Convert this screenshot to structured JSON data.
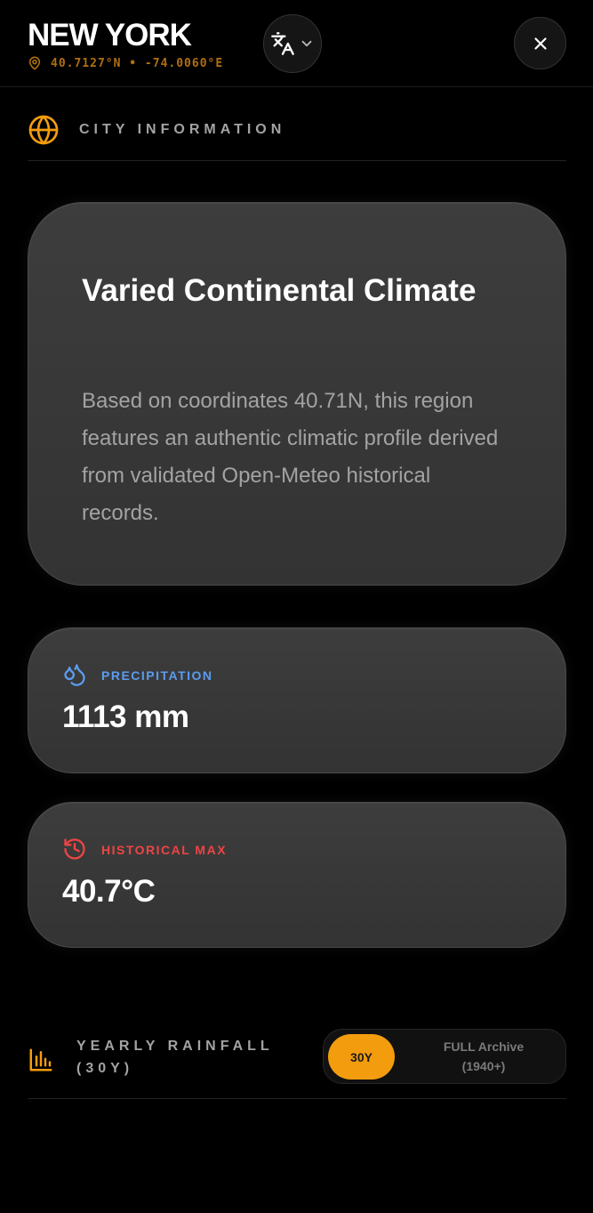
{
  "header": {
    "city": "NEW YORK",
    "coords": "40.7127°N • -74.0060°E",
    "lang_icon": "translate-icon",
    "close_icon": "close-icon"
  },
  "section": {
    "title": "CITY INFORMATION",
    "icon": "globe-icon"
  },
  "climate": {
    "title": "Varied Continental Climate",
    "description": "Based on coordinates 40.71N, this region features an authentic climatic profile derived from validated Open-Meteo historical records."
  },
  "stats": {
    "precipitation": {
      "label": "PRECIPITATION",
      "value": "1113 mm",
      "icon": "droplets-icon",
      "color": "#5b9cf0"
    },
    "historical_max": {
      "label": "HISTORICAL MAX",
      "value": "40.7°C",
      "icon": "history-icon",
      "color": "#ee4444"
    }
  },
  "rainfall": {
    "title": "YEARLY RAINFALL (30Y)",
    "icon": "bar-chart-icon",
    "toggle_30y": "30Y",
    "toggle_full_line1": "FULL Archive",
    "toggle_full_line2": "(1940+)",
    "accent": "#f39c0e"
  }
}
